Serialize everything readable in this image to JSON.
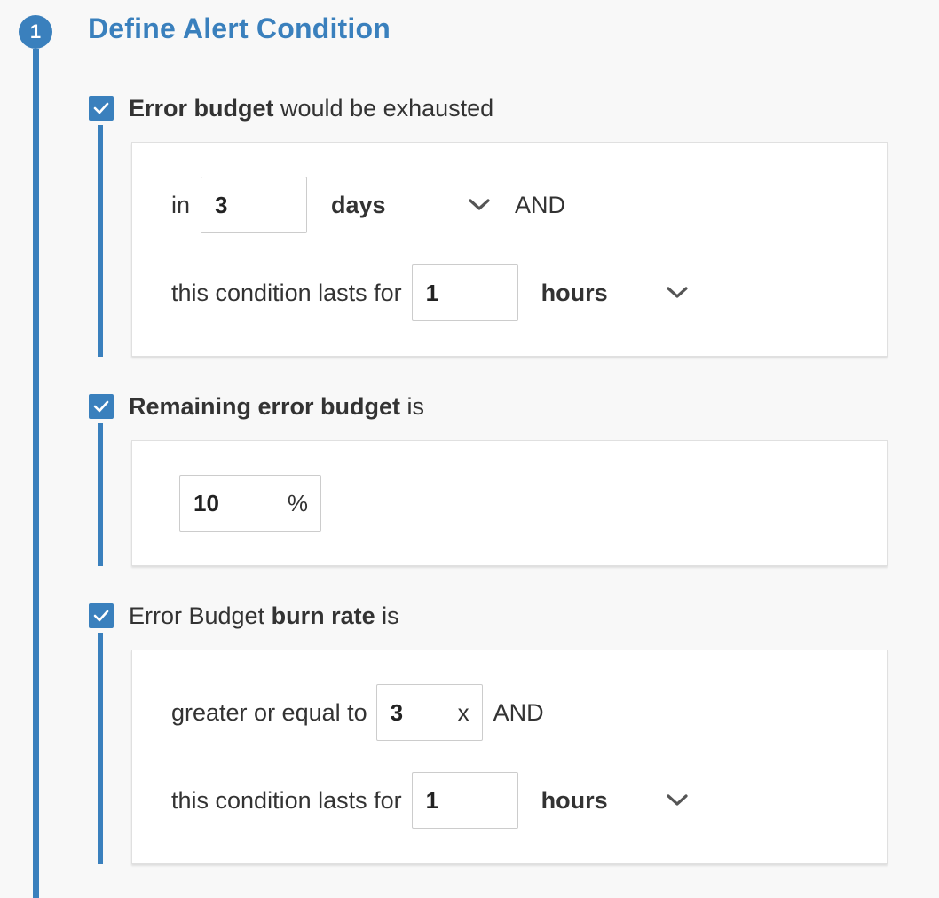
{
  "step": {
    "number": "1",
    "title": "Define Alert Condition"
  },
  "accent_color": "#3a80bd",
  "conditions": {
    "exhaustion": {
      "checked": true,
      "label_bold": "Error budget",
      "label_rest": " would be exhausted",
      "in_label": "in",
      "in_value": "3",
      "in_unit": "days",
      "and_label": "AND",
      "lasts_label": "this condition lasts for",
      "lasts_value": "1",
      "lasts_unit": "hours"
    },
    "remaining": {
      "checked": true,
      "label_bold": "Remaining error budget",
      "label_rest": " is",
      "value": "10",
      "unit": "%"
    },
    "burn_rate": {
      "checked": true,
      "label_prefix": "Error Budget ",
      "label_bold": "burn rate",
      "label_rest": " is",
      "gte_label": "greater or equal to",
      "gte_value": "3",
      "gte_unit": "x",
      "and_label": "AND",
      "lasts_label": "this condition lasts for",
      "lasts_value": "1",
      "lasts_unit": "hours"
    }
  },
  "icons": {
    "checkbox": "checkmark-icon",
    "dropdown": "chevron-down-icon"
  }
}
